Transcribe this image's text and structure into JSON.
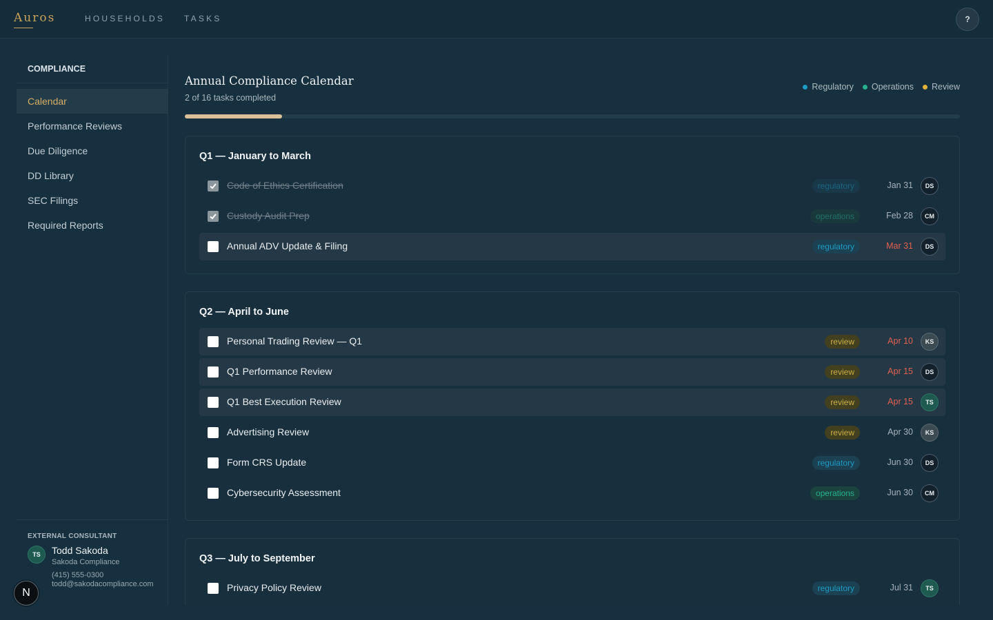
{
  "app": {
    "logo": "Auros"
  },
  "nav": {
    "households": "HOUSEHOLDS",
    "tasks": "TASKS"
  },
  "help": {
    "label": "?"
  },
  "sidebar": {
    "title": "COMPLIANCE",
    "items": [
      {
        "label": "Calendar",
        "active": true
      },
      {
        "label": "Performance Reviews"
      },
      {
        "label": "Due Diligence"
      },
      {
        "label": "DD Library"
      },
      {
        "label": "SEC Filings"
      },
      {
        "label": "Required Reports"
      }
    ],
    "consultant": {
      "kicker": "EXTERNAL CONSULTANT",
      "initials": "TS",
      "name": "Todd Sakoda",
      "company": "Sakoda Compliance",
      "phone": "(415) 555-0300",
      "email": "todd@sakodacompliance.com"
    }
  },
  "n_badge": "N",
  "header": {
    "title": "Annual Compliance Calendar",
    "subtitle": "2 of 16 tasks completed",
    "progress": 0.125
  },
  "legend": {
    "regulatory": "Regulatory",
    "operations": "Operations",
    "review": "Review"
  },
  "colors": {
    "regulatory": "#1c9bc4",
    "operations": "#27b08f",
    "review": "#e2b23a",
    "accent": "#d6ad62",
    "overdue": "#e2604f"
  },
  "quarters": [
    {
      "title": "Q1 — January to March",
      "tasks": [
        {
          "name": "Code of Ethics Certification",
          "tag": "regulatory",
          "due": "Jan 31",
          "assignee": "DS",
          "done": true
        },
        {
          "name": "Custody Audit Prep",
          "tag": "operations",
          "due": "Feb 28",
          "assignee": "CM",
          "done": true
        },
        {
          "name": "Annual ADV Update & Filing",
          "tag": "regulatory",
          "due": "Mar 31",
          "assignee": "DS",
          "done": false,
          "overdue": true
        }
      ]
    },
    {
      "title": "Q2 — April to June",
      "tasks": [
        {
          "name": "Personal Trading Review — Q1",
          "tag": "review",
          "due": "Apr 10",
          "assignee": "KS",
          "done": false,
          "overdue": true
        },
        {
          "name": "Q1 Performance Review",
          "tag": "review",
          "due": "Apr 15",
          "assignee": "DS",
          "done": false,
          "overdue": true
        },
        {
          "name": "Q1 Best Execution Review",
          "tag": "review",
          "due": "Apr 15",
          "assignee": "TS",
          "done": false,
          "overdue": true
        },
        {
          "name": "Advertising Review",
          "tag": "review",
          "due": "Apr 30",
          "assignee": "KS",
          "done": false
        },
        {
          "name": "Form CRS Update",
          "tag": "regulatory",
          "due": "Jun 30",
          "assignee": "DS",
          "done": false
        },
        {
          "name": "Cybersecurity Assessment",
          "tag": "operations",
          "due": "Jun 30",
          "assignee": "CM",
          "done": false
        }
      ]
    },
    {
      "title": "Q3 — July to September",
      "tasks": [
        {
          "name": "Privacy Policy Review",
          "tag": "regulatory",
          "due": "Jul 31",
          "assignee": "TS",
          "done": false
        }
      ]
    }
  ]
}
